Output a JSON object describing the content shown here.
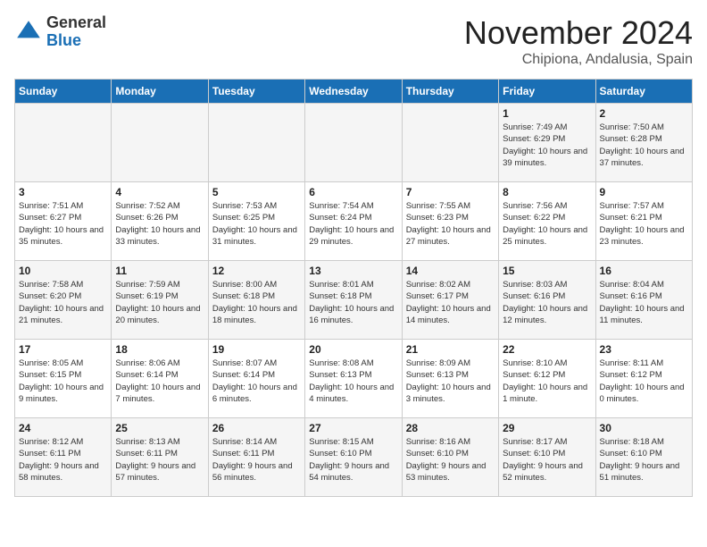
{
  "logo": {
    "general": "General",
    "blue": "Blue"
  },
  "title": "November 2024",
  "subtitle": "Chipiona, Andalusia, Spain",
  "days_header": [
    "Sunday",
    "Monday",
    "Tuesday",
    "Wednesday",
    "Thursday",
    "Friday",
    "Saturday"
  ],
  "weeks": [
    [
      {
        "day": "",
        "info": ""
      },
      {
        "day": "",
        "info": ""
      },
      {
        "day": "",
        "info": ""
      },
      {
        "day": "",
        "info": ""
      },
      {
        "day": "",
        "info": ""
      },
      {
        "day": "1",
        "info": "Sunrise: 7:49 AM\nSunset: 6:29 PM\nDaylight: 10 hours and 39 minutes."
      },
      {
        "day": "2",
        "info": "Sunrise: 7:50 AM\nSunset: 6:28 PM\nDaylight: 10 hours and 37 minutes."
      }
    ],
    [
      {
        "day": "3",
        "info": "Sunrise: 7:51 AM\nSunset: 6:27 PM\nDaylight: 10 hours and 35 minutes."
      },
      {
        "day": "4",
        "info": "Sunrise: 7:52 AM\nSunset: 6:26 PM\nDaylight: 10 hours and 33 minutes."
      },
      {
        "day": "5",
        "info": "Sunrise: 7:53 AM\nSunset: 6:25 PM\nDaylight: 10 hours and 31 minutes."
      },
      {
        "day": "6",
        "info": "Sunrise: 7:54 AM\nSunset: 6:24 PM\nDaylight: 10 hours and 29 minutes."
      },
      {
        "day": "7",
        "info": "Sunrise: 7:55 AM\nSunset: 6:23 PM\nDaylight: 10 hours and 27 minutes."
      },
      {
        "day": "8",
        "info": "Sunrise: 7:56 AM\nSunset: 6:22 PM\nDaylight: 10 hours and 25 minutes."
      },
      {
        "day": "9",
        "info": "Sunrise: 7:57 AM\nSunset: 6:21 PM\nDaylight: 10 hours and 23 minutes."
      }
    ],
    [
      {
        "day": "10",
        "info": "Sunrise: 7:58 AM\nSunset: 6:20 PM\nDaylight: 10 hours and 21 minutes."
      },
      {
        "day": "11",
        "info": "Sunrise: 7:59 AM\nSunset: 6:19 PM\nDaylight: 10 hours and 20 minutes."
      },
      {
        "day": "12",
        "info": "Sunrise: 8:00 AM\nSunset: 6:18 PM\nDaylight: 10 hours and 18 minutes."
      },
      {
        "day": "13",
        "info": "Sunrise: 8:01 AM\nSunset: 6:18 PM\nDaylight: 10 hours and 16 minutes."
      },
      {
        "day": "14",
        "info": "Sunrise: 8:02 AM\nSunset: 6:17 PM\nDaylight: 10 hours and 14 minutes."
      },
      {
        "day": "15",
        "info": "Sunrise: 8:03 AM\nSunset: 6:16 PM\nDaylight: 10 hours and 12 minutes."
      },
      {
        "day": "16",
        "info": "Sunrise: 8:04 AM\nSunset: 6:16 PM\nDaylight: 10 hours and 11 minutes."
      }
    ],
    [
      {
        "day": "17",
        "info": "Sunrise: 8:05 AM\nSunset: 6:15 PM\nDaylight: 10 hours and 9 minutes."
      },
      {
        "day": "18",
        "info": "Sunrise: 8:06 AM\nSunset: 6:14 PM\nDaylight: 10 hours and 7 minutes."
      },
      {
        "day": "19",
        "info": "Sunrise: 8:07 AM\nSunset: 6:14 PM\nDaylight: 10 hours and 6 minutes."
      },
      {
        "day": "20",
        "info": "Sunrise: 8:08 AM\nSunset: 6:13 PM\nDaylight: 10 hours and 4 minutes."
      },
      {
        "day": "21",
        "info": "Sunrise: 8:09 AM\nSunset: 6:13 PM\nDaylight: 10 hours and 3 minutes."
      },
      {
        "day": "22",
        "info": "Sunrise: 8:10 AM\nSunset: 6:12 PM\nDaylight: 10 hours and 1 minute."
      },
      {
        "day": "23",
        "info": "Sunrise: 8:11 AM\nSunset: 6:12 PM\nDaylight: 10 hours and 0 minutes."
      }
    ],
    [
      {
        "day": "24",
        "info": "Sunrise: 8:12 AM\nSunset: 6:11 PM\nDaylight: 9 hours and 58 minutes."
      },
      {
        "day": "25",
        "info": "Sunrise: 8:13 AM\nSunset: 6:11 PM\nDaylight: 9 hours and 57 minutes."
      },
      {
        "day": "26",
        "info": "Sunrise: 8:14 AM\nSunset: 6:11 PM\nDaylight: 9 hours and 56 minutes."
      },
      {
        "day": "27",
        "info": "Sunrise: 8:15 AM\nSunset: 6:10 PM\nDaylight: 9 hours and 54 minutes."
      },
      {
        "day": "28",
        "info": "Sunrise: 8:16 AM\nSunset: 6:10 PM\nDaylight: 9 hours and 53 minutes."
      },
      {
        "day": "29",
        "info": "Sunrise: 8:17 AM\nSunset: 6:10 PM\nDaylight: 9 hours and 52 minutes."
      },
      {
        "day": "30",
        "info": "Sunrise: 8:18 AM\nSunset: 6:10 PM\nDaylight: 9 hours and 51 minutes."
      }
    ]
  ]
}
